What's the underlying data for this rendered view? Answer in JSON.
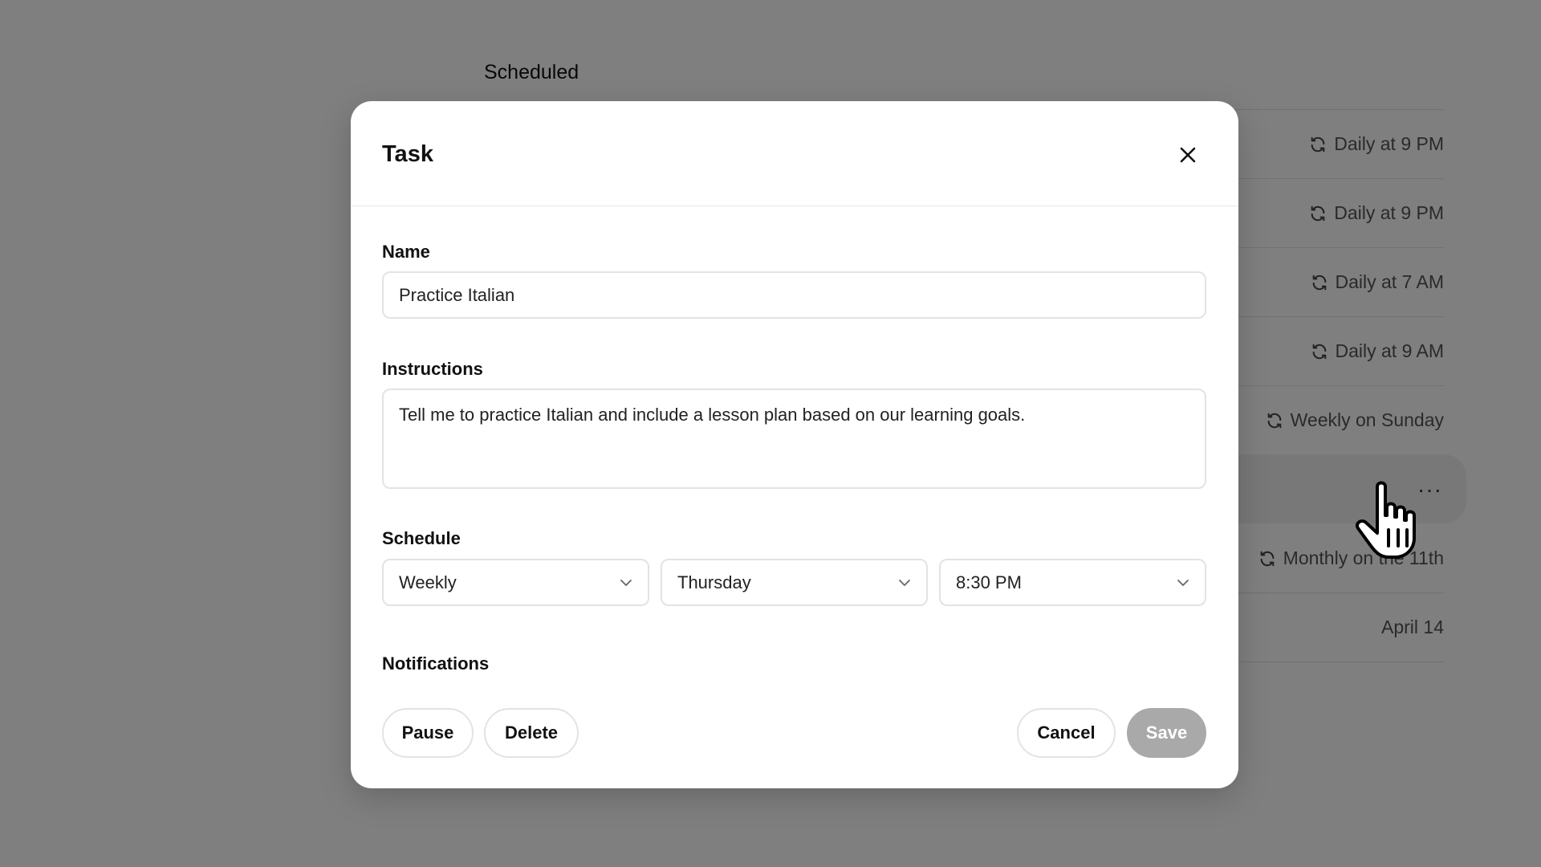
{
  "background": {
    "title": "Scheduled",
    "rows": [
      {
        "schedule": "Daily at 9 PM",
        "icon": "repeat-icon"
      },
      {
        "schedule": "Daily at 9 PM",
        "icon": "repeat-icon"
      },
      {
        "schedule": "Daily at 7 AM",
        "icon": "repeat-icon"
      },
      {
        "schedule": "Daily at 9 AM",
        "icon": "repeat-icon"
      },
      {
        "schedule": "Weekly on Sunday",
        "icon": "repeat-icon"
      },
      {
        "schedule": "",
        "icon": "more-icon",
        "more_label": "···"
      },
      {
        "schedule": "Monthly on the 11th",
        "icon": "repeat-icon"
      },
      {
        "schedule": "April 14",
        "icon": ""
      }
    ]
  },
  "modal": {
    "title": "Task",
    "name": {
      "label": "Name",
      "value": "Practice Italian"
    },
    "instructions": {
      "label": "Instructions",
      "value": "Tell me to practice Italian and include a lesson plan based on our learning goals."
    },
    "schedule": {
      "label": "Schedule",
      "frequency": "Weekly",
      "day": "Thursday",
      "time": "8:30 PM"
    },
    "notifications": {
      "label": "Notifications"
    },
    "buttons": {
      "pause": "Pause",
      "delete": "Delete",
      "cancel": "Cancel",
      "save": "Save"
    }
  },
  "colors": {
    "overlay": "#7f7f7f",
    "save_disabled": "#a9a9a9",
    "border": "#e3e3e3"
  }
}
